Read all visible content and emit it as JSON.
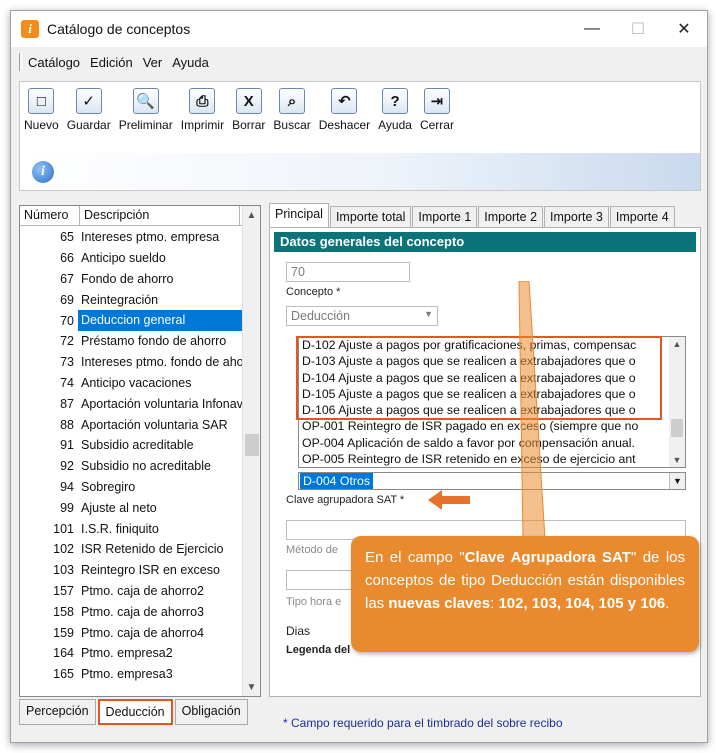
{
  "window": {
    "title": "Catálogo de conceptos",
    "controls": [
      "—",
      "☐",
      "✕"
    ]
  },
  "menu": [
    "Catálogo",
    "Edición",
    "Ver",
    "Ayuda"
  ],
  "toolbar": [
    {
      "id": "nuevo",
      "label": "Nuevo",
      "glyph": "□"
    },
    {
      "id": "guardar",
      "label": "Guardar",
      "glyph": "✓"
    },
    {
      "id": "preliminar",
      "label": "Preliminar",
      "glyph": "🔍"
    },
    {
      "id": "imprimir",
      "label": "Imprimir",
      "glyph": "⎙"
    },
    {
      "id": "borrar",
      "label": "Borrar",
      "glyph": "X"
    },
    {
      "id": "buscar",
      "label": "Buscar",
      "glyph": "⌕"
    },
    {
      "id": "deshacer",
      "label": "Deshacer",
      "glyph": "↶"
    },
    {
      "id": "ayuda",
      "label": "Ayuda",
      "glyph": "?"
    },
    {
      "id": "cerrar",
      "label": "Cerrar",
      "glyph": "⇥"
    }
  ],
  "list": {
    "headers": [
      "Número",
      "Descripción"
    ],
    "rows": [
      [
        "65",
        "Intereses ptmo. empresa"
      ],
      [
        "66",
        "Anticipo sueldo"
      ],
      [
        "67",
        "Fondo de ahorro"
      ],
      [
        "69",
        "Reintegración"
      ],
      [
        "70",
        "Deduccion general"
      ],
      [
        "72",
        "Préstamo fondo de ahorro"
      ],
      [
        "73",
        "Intereses ptmo. fondo de ahorro"
      ],
      [
        "74",
        "Anticipo vacaciones"
      ],
      [
        "87",
        "Aportación voluntaria Infonavit"
      ],
      [
        "88",
        "Aportación voluntaria SAR"
      ],
      [
        "91",
        "Subsidio acreditable"
      ],
      [
        "92",
        "Subsidio no acreditable"
      ],
      [
        "94",
        "Sobregiro"
      ],
      [
        "99",
        "Ajuste al neto"
      ],
      [
        "101",
        "I.S.R. finiquito"
      ],
      [
        "102",
        "ISR Retenido de Ejercicio"
      ],
      [
        "103",
        "Reintegro ISR en exceso"
      ],
      [
        "157",
        "Ptmo. caja de ahorro2"
      ],
      [
        "158",
        "Ptmo. caja de ahorro3"
      ],
      [
        "159",
        "Ptmo. caja de ahorro4"
      ],
      [
        "164",
        "Ptmo. empresa2"
      ],
      [
        "165",
        "Ptmo. empresa3"
      ]
    ],
    "selected_index": 4
  },
  "bottom_tabs": [
    "Percepción",
    "Deducción",
    "Obligación"
  ],
  "right_tabs": [
    "Principal",
    "Importe total",
    "Importe 1",
    "Importe 2",
    "Importe 3",
    "Importe 4"
  ],
  "form": {
    "section_title": "Datos generales del concepto",
    "concepto_value": "70",
    "concepto_label": "Concepto *",
    "tipo_value": "Deducción",
    "sat_codes": [
      "D-102  Ajuste a pagos por gratificaciones, primas, compensac",
      "D-103  Ajuste a pagos que se realicen a extrabajadores que o",
      "D-104  Ajuste a pagos que se realicen a extrabajadores que o",
      "D-105  Ajuste a pagos que se realicen a extrabajadores que o",
      "D-106  Ajuste a pagos que se realicen a extrabajadores que o",
      "OP-001 Reintegro de ISR pagado en exceso (siempre que no",
      "OP-004 Aplicación de saldo a favor por compensación anual.",
      "OP-005 Reintegro de ISR retenido en exceso de ejercicio ant"
    ],
    "sat_selected": "D-004  Otros",
    "sat_label": "Clave agrupadora SAT *",
    "metodo_label": "Método de",
    "tipo_hora_label": "Tipo hora e",
    "dias_label": "Dias",
    "leyenda_label": "Legenda del"
  },
  "callout": {
    "p1": "En el campo \"",
    "b1": "Clave Agrupadora SAT",
    "p2": "\" de los conceptos de tipo Deducción están disponibles las ",
    "b2": "nuevas claves",
    "p3": ": ",
    "b3": "102, 103, 104, 105 y 106",
    "p4": "."
  },
  "footer_note": "* Campo requerido para el timbrado del sobre recibo",
  "colors": {
    "accent": "#e2571f",
    "header": "#0c7478",
    "selection": "#0078d7",
    "callout": "#e98a2e"
  }
}
